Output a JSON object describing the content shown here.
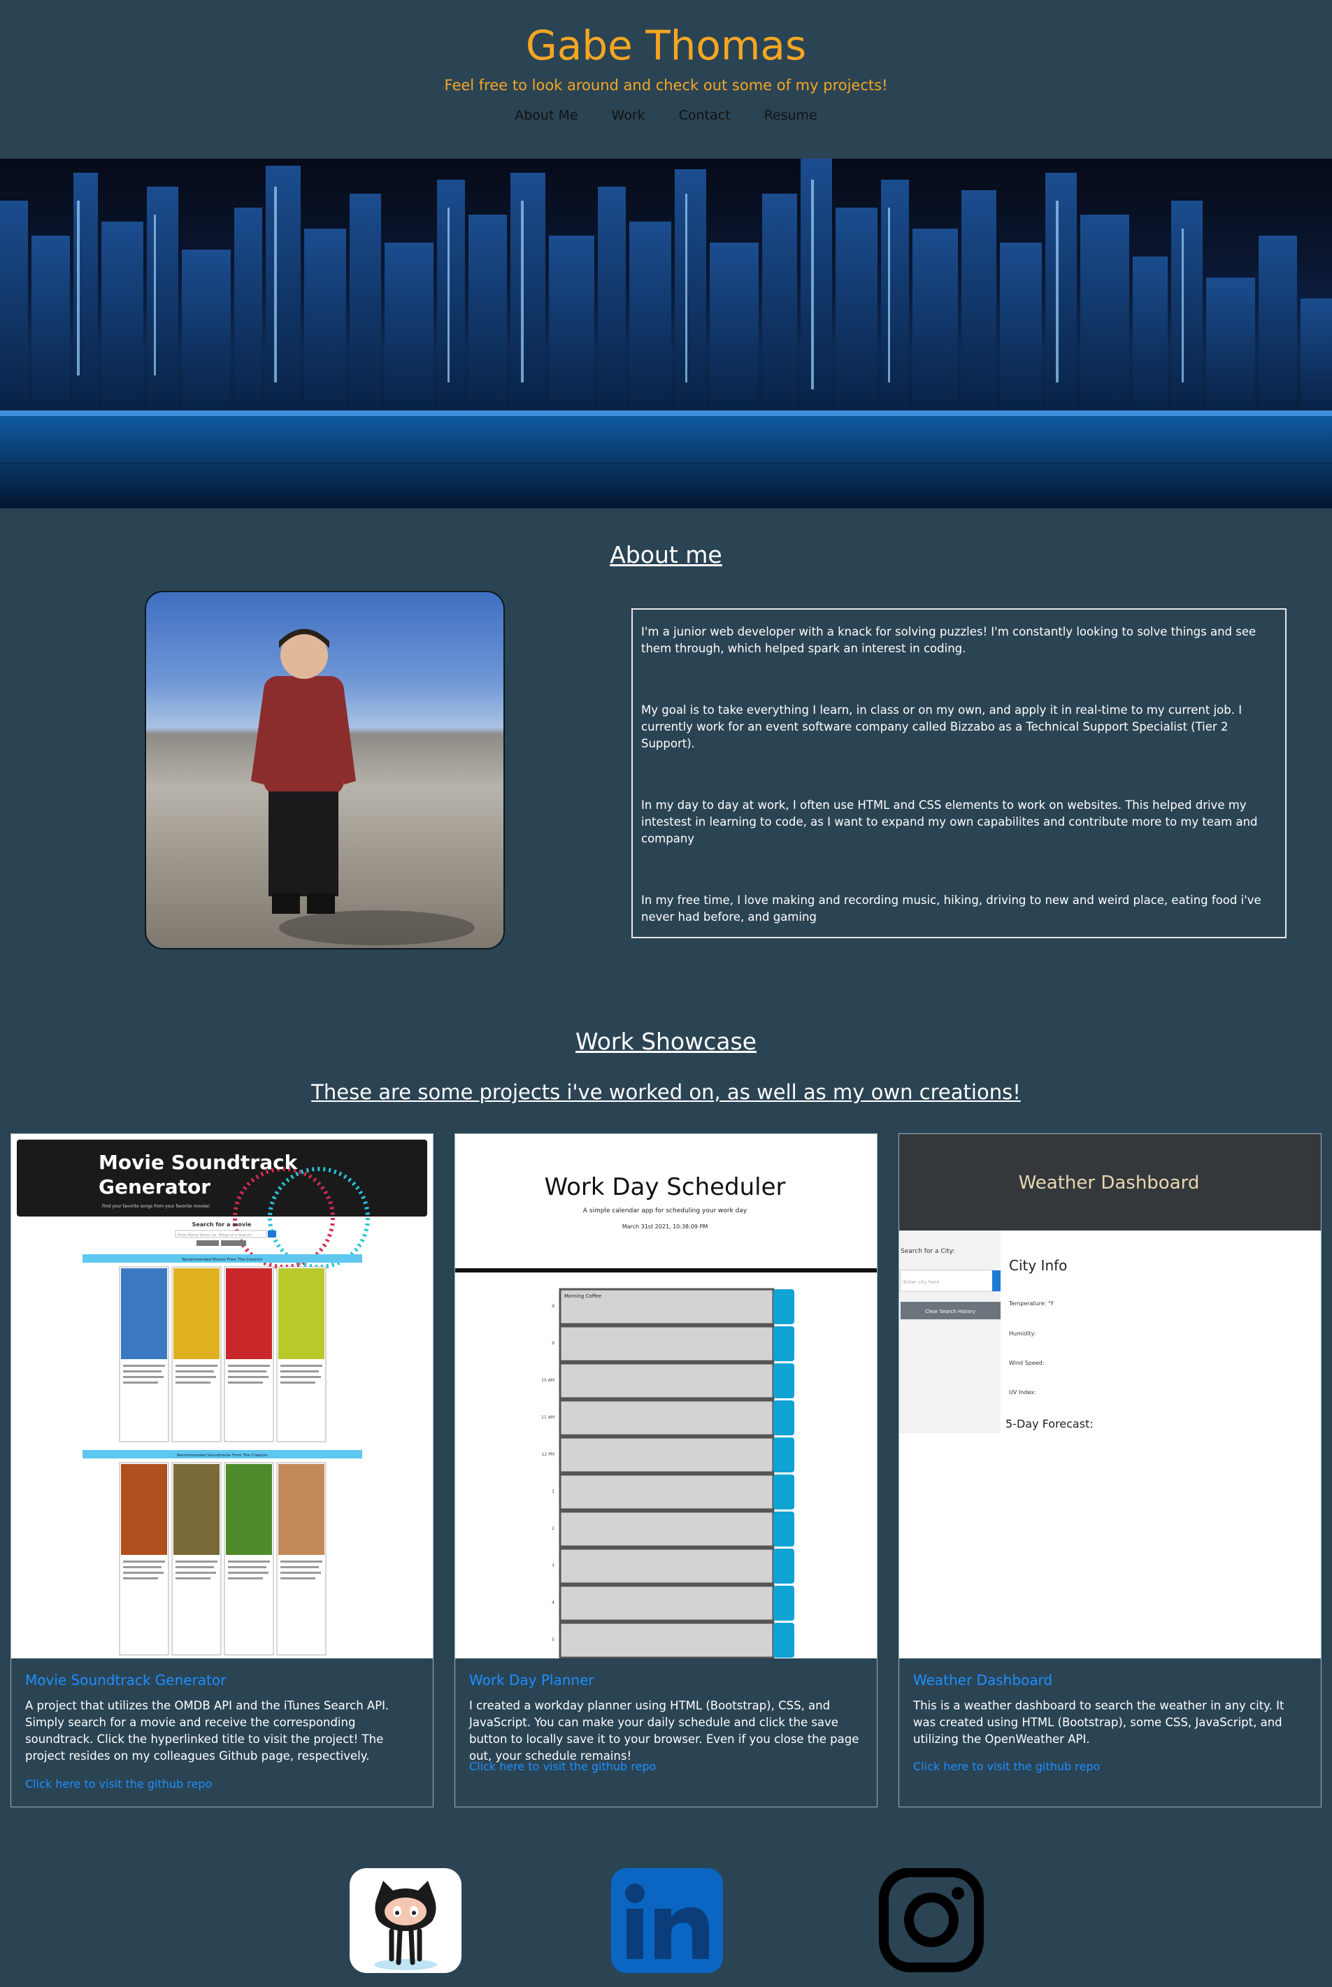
{
  "header": {
    "title": "Gabe Thomas",
    "tagline": "Feel free to look around and check out some of my projects!",
    "nav": [
      {
        "label": "About Me"
      },
      {
        "label": "Work"
      },
      {
        "label": "Contact"
      },
      {
        "label": "Resume"
      }
    ]
  },
  "about": {
    "heading": "About me",
    "paragraphs": [
      "I'm a junior web developer with a knack for solving puzzles! I'm constantly looking to solve things and see them through, which helped spark an interest in coding.",
      "My goal is to take everything I learn, in class or on my own, and apply it in real-time to my current job. I currently work for an event software company called Bizzabo as a Technical Support Specialist (Tier 2 Support).",
      "In my day to day at work, I often use HTML and CSS elements to work on websites. This helped drive my intestest in learning to code, as I want to expand my own capabilites and contribute more to my team and company",
      "In my free time, I love making and recording music, hiking, driving to new and weird place, eating food i've never had before, and gaming"
    ]
  },
  "work": {
    "heading": "Work Showcase",
    "subheading": "These are some projects i've worked on, as well as my own creations!",
    "projects": [
      {
        "title": "Movie Soundtrack Generator",
        "description": "A project that utilizes the OMDB API and the iTunes Search API. Simply search for a movie and receive the corresponding soundtrack. Click the hyperlinked title to visit the project! The project resides on my colleagues Github page, respectively.",
        "link": "Click here to visit the github repo",
        "screenshot": {
          "banner_line1": "Movie Soundtrack",
          "banner_line2": "Generator",
          "banner_sub": "Find your favorite songs from your favorite movies!",
          "search_label": "Search for a movie",
          "search_placeholder": "Enter Movie Name (ex. Wings or a Search)",
          "section1": "Recommended Movies From The Creators",
          "section2": "Recommended Soundtracks From The Creators"
        }
      },
      {
        "title": "Work Day Planner",
        "description": "I created a workday planner using HTML (Bootstrap), CSS, and JavaScript. You can make your daily schedule and click the save button to locally save it to your browser. Even if you close the page out, your schedule remains!",
        "link": "Click here to visit the github repo",
        "screenshot": {
          "heading": "Work Day Scheduler",
          "sub": "A simple calendar app for scheduling your work day",
          "date": "March 31st 2021, 10:38:09 PM",
          "first_entry": "Morning Coffee",
          "hours": [
            "9",
            "9",
            "10 AM",
            "11 AM",
            "12 PM",
            "1",
            "2",
            "3",
            "4",
            "5"
          ]
        }
      },
      {
        "title": "Weather Dashboard",
        "description": "This is a weather dashboard to search the weather in any city. It was created using HTML (Bootstrap), some CSS, JavaScript, and utilizing the OpenWeather API.",
        "link": "Click here to visit the github repo",
        "screenshot": {
          "heading": "Weather Dashboard",
          "search_label": "Search for a City:",
          "search_placeholder": "Enter city here",
          "history_button": "Clear Search History",
          "info_title": "City Info",
          "fields": [
            "Temperature: °F",
            "Humidity:",
            "Wind Speed:",
            "UV Index:"
          ],
          "forecast": "5-Day Forecast:"
        }
      }
    ]
  },
  "social": [
    {
      "icon": "github-icon"
    },
    {
      "icon": "linkedin-icon"
    },
    {
      "icon": "instagram-icon"
    }
  ],
  "colors": {
    "background": "#2b4454",
    "accent": "#f5a623",
    "link": "#1e8fff"
  }
}
